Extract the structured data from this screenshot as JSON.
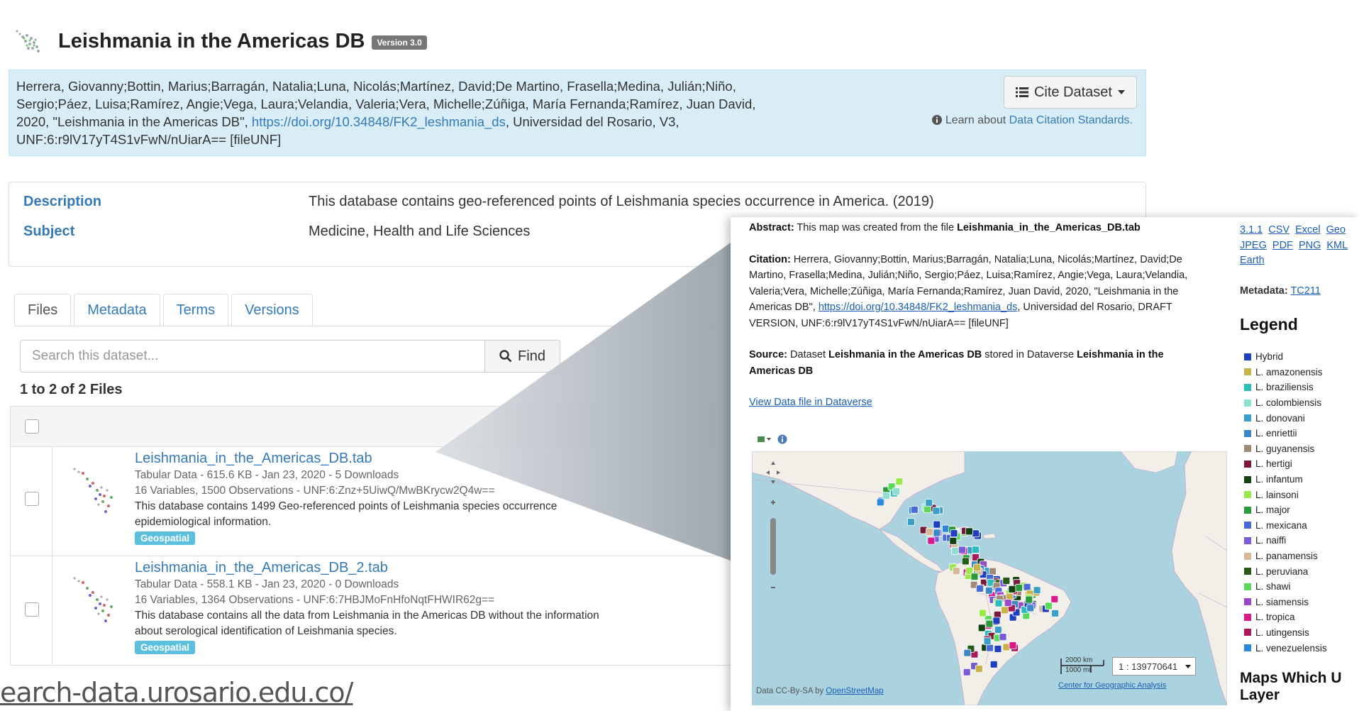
{
  "dataset": {
    "title": "Leishmania in the Americas DB",
    "version": "Version 3.0"
  },
  "citation": {
    "text_pre": "Herrera, Giovanny;Bottin, Marius;Barragán, Natalia;Luna, Nicolás;Martínez, David;De Martino, Frasella;Medina, Julián;Niño, Sergio;Páez, Luisa;Ramírez, Angie;Vega, Laura;Velandia, Valeria;Vera, Michelle;Zúñiga, María Fernanda;Ramírez, Juan David, 2020, \"Leishmania in the Americas DB\", ",
    "doi": "https://doi.org/10.34848/FK2_leshmania_ds",
    "text_post": ", Universidad del Rosario, V3, UNF:6:r9lV17yT4S1vFwN/nUiarA== [fileUNF]",
    "cite_button": "Cite Dataset",
    "learn_prefix": "Learn about ",
    "learn_link": "Data Citation Standards."
  },
  "metadata": {
    "description_label": "Description",
    "description_value": "This database contains geo-referenced points of Leishmania species occurrence in America. (2019)",
    "subject_label": "Subject",
    "subject_value": "Medicine, Health and Life Sciences"
  },
  "tabs": [
    "Files",
    "Metadata",
    "Terms",
    "Versions"
  ],
  "search": {
    "placeholder": "Search this dataset...",
    "find_label": "Find"
  },
  "files_count": "1 to 2 of 2 Files",
  "files": [
    {
      "name": "Leishmania_in_the_Americas_DB.tab",
      "line1": "Tabular Data - 615.6 KB - Jan 23, 2020 - 5 Downloads",
      "line2": "16 Variables, 1500 Observations - UNF:6:Znz+5UiwQ/MwBKrycw2Q4w==",
      "desc1": "This database contains 1499 Geo-referenced points of Leishmania species occurrence",
      "desc2": "epidemiological information.",
      "badge": "Geospatial"
    },
    {
      "name": "Leishmania_in_the_Americas_DB_2.tab",
      "line1": "Tabular Data - 558.1 KB - Jan 23, 2020 - 0 Downloads",
      "line2": "16 Variables, 1364 Observations - UNF:6:7HBJMoFnHfoNqtFHWIR62g==",
      "desc1": "This database contains all the data from Leishmania in the Americas DB without the information",
      "desc2": "about serological identification of Leishmania species.",
      "badge": "Geospatial"
    }
  ],
  "url_caption": "earch-data.urosario.edu.co/",
  "geo": {
    "abstract_label": "Abstract:",
    "abstract_text": " This map was created from the file ",
    "abstract_file": "Leishmania_in_the_Americas_DB.tab",
    "citation_label": "Citation:",
    "citation_text": " Herrera, Giovanny;Bottin, Marius;Barragán, Natalia;Luna, Nicolás;Martínez, David;De Martino, Frasella;Medina, Julián;Niño, Sergio;Páez, Luisa;Ramírez, Angie;Vega, Laura;Velandia, Valeria;Vera, Michelle;Zúñiga, María Fernanda;Ramírez, Juan David, 2020, \"Leishmania in the Americas DB\", ",
    "citation_doi": "https://doi.org/10.34848/FK2_leshmania_ds",
    "citation_post": ", Universidad del Rosario, DRAFT VERSION, UNF:6:r9lV17yT4S1vFwN/nUiarA== [fileUNF]",
    "source_label": "Source:",
    "source_text1": " Dataset ",
    "source_dataset": "Leishmania in the Americas DB",
    "source_text2": " stored in Dataverse ",
    "source_dataverse": "Leishmania in the Americas DB",
    "view_link": "View Data file in Dataverse",
    "scale_km": "2000 km",
    "scale_mi": "1000 mi",
    "scale_ratio": "1 : 139770641",
    "attrib_prefix": "Data CC-By-SA by ",
    "attrib_link": "OpenStreetMap",
    "center_link": "Center for Geographic Analysis",
    "formats": [
      "3.1.1",
      "CSV",
      "Excel",
      "Geo",
      "JPEG",
      "PDF",
      "PNG",
      "KML",
      "Earth"
    ],
    "metadata_label": "Metadata:",
    "metadata_link": "TC211",
    "legend_title": "Legend",
    "legend": [
      {
        "label": "Hybrid",
        "color": "#1f3fbf"
      },
      {
        "label": "L. amazonensis",
        "color": "#c8b34a"
      },
      {
        "label": "L. braziliensis",
        "color": "#2bbdbd"
      },
      {
        "label": "L. colombiensis",
        "color": "#8fded0"
      },
      {
        "label": "L. donovani",
        "color": "#3aa0c8"
      },
      {
        "label": "L. enriettii",
        "color": "#3a88c8"
      },
      {
        "label": "L. guyanensis",
        "color": "#a08a78"
      },
      {
        "label": "L. hertigi",
        "color": "#7a1a3a"
      },
      {
        "label": "L. infantum",
        "color": "#114411"
      },
      {
        "label": "L. lainsoni",
        "color": "#9be84a"
      },
      {
        "label": "L. major",
        "color": "#2a9a3a"
      },
      {
        "label": "L. mexicana",
        "color": "#4a6ad8"
      },
      {
        "label": "L. naiffi",
        "color": "#7a5ad8"
      },
      {
        "label": "L. panamensis",
        "color": "#d8b898"
      },
      {
        "label": "L. peruviana",
        "color": "#2a5a1a"
      },
      {
        "label": "L. shawi",
        "color": "#5ad85a"
      },
      {
        "label": "L. siamensis",
        "color": "#9a4ac8"
      },
      {
        "label": "L. tropica",
        "color": "#d81a8a"
      },
      {
        "label": "L. utingensis",
        "color": "#a81a5a"
      },
      {
        "label": "L. venezuelensis",
        "color": "#2a8ad8"
      }
    ],
    "maps_which": "Maps Which U",
    "maps_layer": "Layer"
  }
}
